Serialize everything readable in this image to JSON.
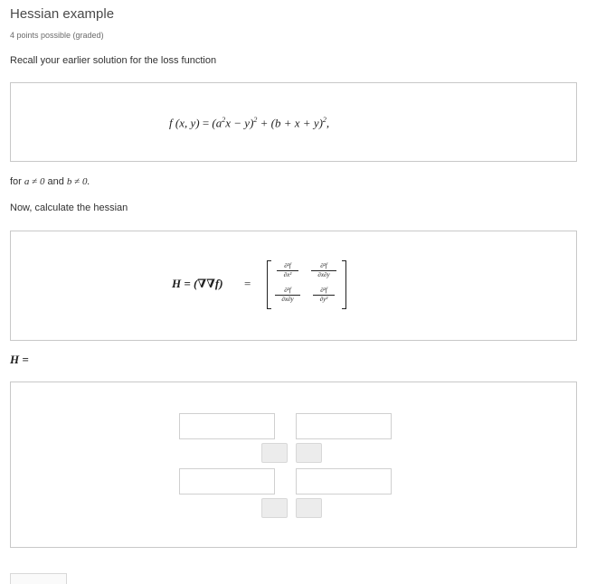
{
  "problem": {
    "title": "Hessian example",
    "points": "4 points possible (graded)",
    "intro": "Recall your earlier solution for the loss function",
    "loss_lhs": "f (x, y)",
    "loss_eq": "=",
    "loss_rhs_a": "(a",
    "loss_rhs_b": "x − y)",
    "loss_rhs_c": " + (b + x + y)",
    "loss_end": ",",
    "sup2": "2",
    "condition_prefix": "for ",
    "condition_a": "a ≠ 0",
    "condition_and": " and ",
    "condition_b": "b ≠ 0.",
    "now_text": "Now, calculate the hessian",
    "hessian_lhs": "H = (∇∇f)",
    "hessian_eq": "=",
    "matrix": {
      "m11_num": "∂²f",
      "m11_den": "∂x²",
      "m12_num": "∂²f",
      "m12_den": "∂x∂y",
      "m21_num": "∂²f",
      "m21_den": "∂x∂y",
      "m22_num": "∂²f",
      "m22_den": "∂y²"
    },
    "answer_label": "H ="
  },
  "answer_inputs": {
    "h11": "",
    "h12": "",
    "h21": "",
    "h22": ""
  }
}
